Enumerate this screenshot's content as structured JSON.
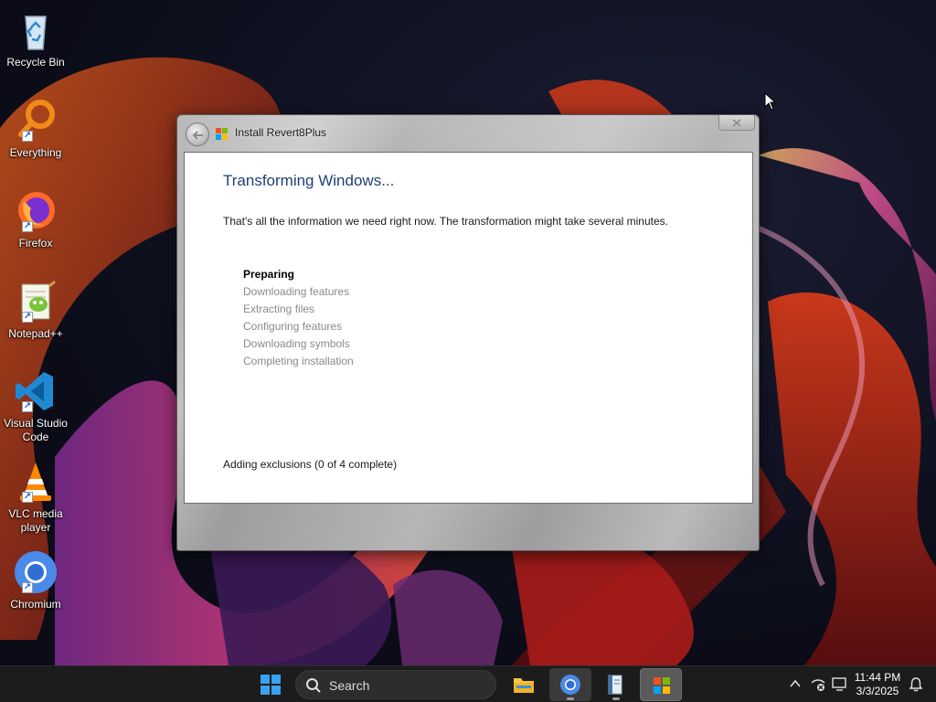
{
  "desktop": {
    "icons": [
      {
        "label": "Recycle Bin",
        "icon": "recycle-bin-icon"
      },
      {
        "label": "Everything",
        "icon": "everything-search-icon"
      },
      {
        "label": "Firefox",
        "icon": "firefox-icon"
      },
      {
        "label": "Notepad++",
        "icon": "notepad-plus-plus-icon"
      },
      {
        "label": "Visual Studio Code",
        "icon": "vscode-icon"
      },
      {
        "label": "VLC media player",
        "icon": "vlc-icon"
      },
      {
        "label": "Chromium",
        "icon": "chromium-icon"
      }
    ]
  },
  "window": {
    "title": "Install Revert8Plus",
    "heading": "Transforming Windows...",
    "info": "That's all the information we need right now. The transformation might take several minutes.",
    "steps": [
      {
        "label": "Preparing",
        "active": true
      },
      {
        "label": "Downloading features",
        "active": false
      },
      {
        "label": "Extracting files",
        "active": false
      },
      {
        "label": "Configuring features",
        "active": false
      },
      {
        "label": "Downloading symbols",
        "active": false
      },
      {
        "label": "Completing installation",
        "active": false
      }
    ],
    "status": "Adding exclusions (0 of 4 complete)"
  },
  "taskbar": {
    "search_placeholder": "Search",
    "apps": [
      "file-explorer-icon",
      "chromium-icon",
      "installer-book-icon",
      "windows-setup-icon"
    ],
    "time": "11:44 PM",
    "date": "3/3/2025"
  },
  "colors": {
    "heading": "#1e3f7a",
    "inactive_step": "#8a8a8a",
    "taskbar": "#1c1c1c"
  }
}
